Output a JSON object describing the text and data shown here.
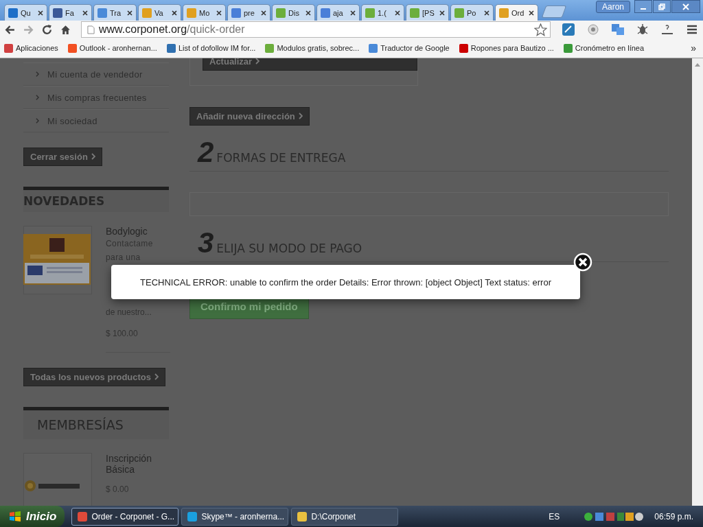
{
  "tabs": [
    {
      "label": "Qu",
      "color": "#1e6fc8",
      "selected": false
    },
    {
      "label": "Fa",
      "color": "#3b5998",
      "selected": false
    },
    {
      "label": "Tra",
      "color": "#4a8ad8",
      "selected": false
    },
    {
      "label": "Va",
      "color": "#e0a020",
      "selected": false
    },
    {
      "label": "Mo",
      "color": "#e0a020",
      "selected": false
    },
    {
      "label": "pre",
      "color": "#4a7fd8",
      "selected": false
    },
    {
      "label": "Dis",
      "color": "#6cae3c",
      "selected": false
    },
    {
      "label": "aja",
      "color": "#4a7fd8",
      "selected": false
    },
    {
      "label": "1.(",
      "color": "#6cae3c",
      "selected": false
    },
    {
      "label": "[PS",
      "color": "#6cae3c",
      "selected": false
    },
    {
      "label": "Po",
      "color": "#6cae3c",
      "selected": false
    },
    {
      "label": "Ord",
      "color": "#e0a020",
      "selected": true
    }
  ],
  "user": "Aaron",
  "address": {
    "host": "www.corponet.org",
    "path": "/quick-order"
  },
  "bookmarks": [
    {
      "label": "Aplicaciones",
      "color": "#d04040"
    },
    {
      "label": "Outlook - aronhernan...",
      "color": "#f25022"
    },
    {
      "label": "List of dofollow IM for...",
      "color": "#3070b0"
    },
    {
      "label": "Modulos gratis, sobrec...",
      "color": "#6cae3c"
    },
    {
      "label": "Traductor de Google",
      "color": "#4a8ad8"
    },
    {
      "label": "Ropones para Bautizo ...",
      "color": "#cc0000"
    },
    {
      "label": "Cronómetro en línea",
      "color": "#3a9a3a"
    }
  ],
  "bookmarks_more": "»",
  "sidebar": {
    "account_links": [
      "Mi cuenta de vendedor",
      "Mis compras frecuentes",
      "Mi sociedad"
    ],
    "logout_button": "Cerrar sesión",
    "news": {
      "title": "NOVEDADES",
      "product": {
        "name": "Bodylogic",
        "description": "Contactame para una",
        "price": "$ 100.00",
        "description_end": "de nuestro..."
      },
      "all_button": "Todas los nuevos productos"
    },
    "memberships": {
      "title": "MEMBRESÍAS",
      "product": {
        "name": "Inscripción Básica",
        "price": "$ 0.00"
      }
    }
  },
  "main": {
    "update_button": "Actualizar",
    "add_address_button": "Añadir nueva dirección",
    "sections": [
      {
        "number": "2",
        "title": "FORMAS DE ENTREGA"
      },
      {
        "number": "3",
        "title": "ELIJA SU MODO DE PAGO"
      }
    ],
    "confirm_button": "Confirmo mi pedido"
  },
  "dialog": {
    "message": "TECHNICAL ERROR: unable to confirm the order Details: Error thrown: [object Object] Text status: error"
  },
  "taskbar": {
    "start": "Inicio",
    "tasks": [
      {
        "label": "Order - Corponet - G...",
        "color": "#e04a3a",
        "selected": true
      },
      {
        "label": "Skype™ - aronherna...",
        "color": "#1aa0e0",
        "selected": false
      },
      {
        "label": "D:\\Corponet",
        "color": "#e8c040",
        "selected": false
      }
    ],
    "language": "ES",
    "time": "06:59 p.m."
  }
}
